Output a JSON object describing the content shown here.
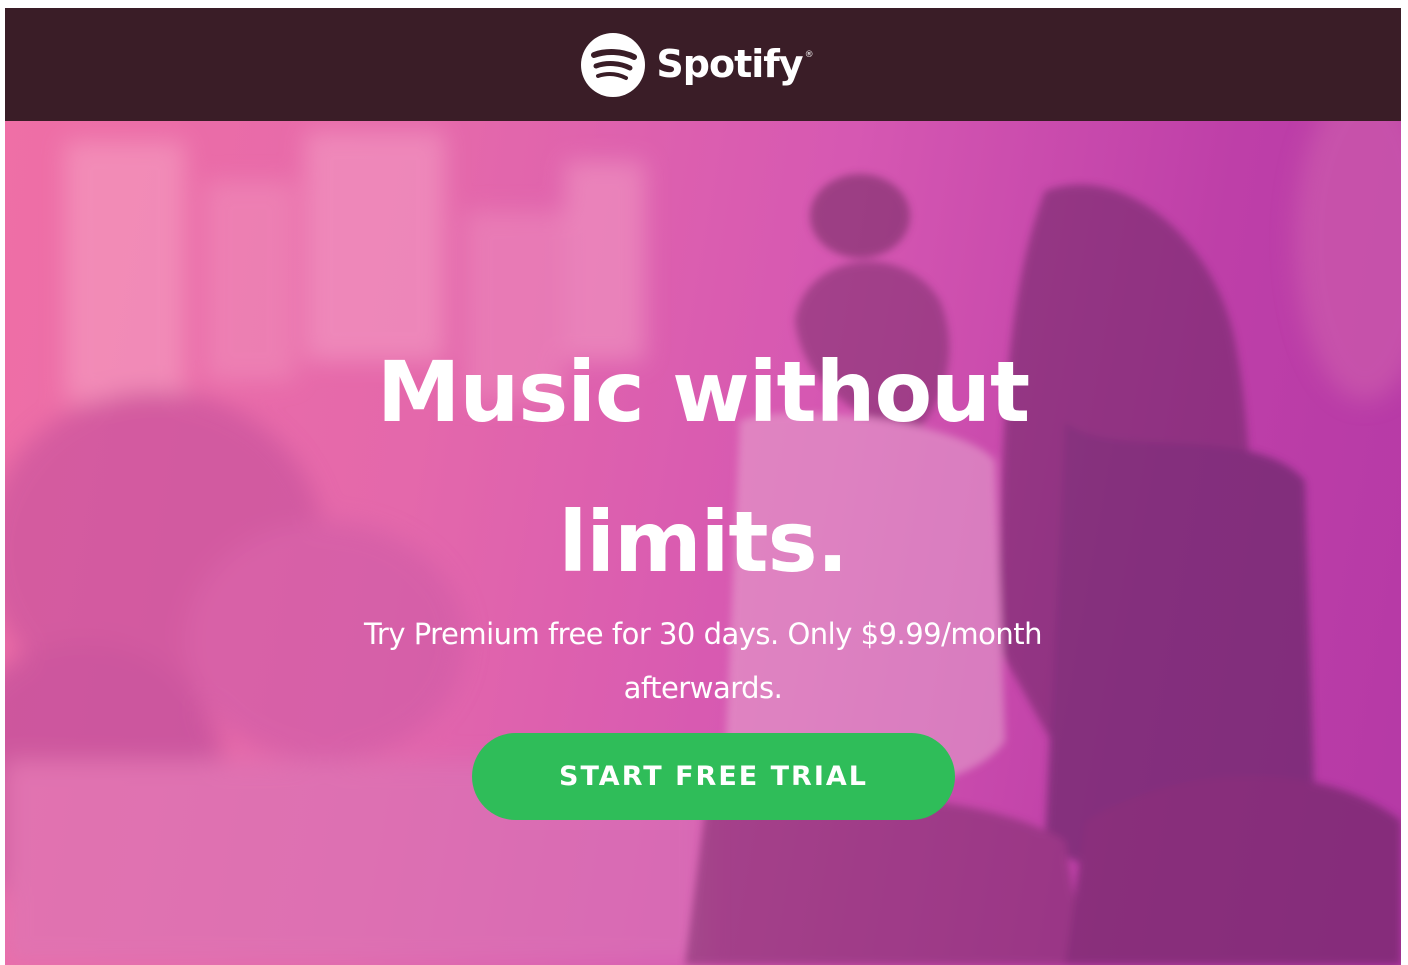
{
  "header": {
    "logo": {
      "wordmark": "Spotify",
      "trademark": "®",
      "icon": "spotify-logo-icon"
    }
  },
  "hero": {
    "headline_line1": "Music without",
    "headline_line2": "limits.",
    "subline_line1": "Try Premium free for 30 days. Only $9.99/month",
    "subline_line2": "afterwards.",
    "cta_label": "START FREE TRIAL"
  },
  "colors": {
    "header_bg": "#3a1d27",
    "hero_pink": "#ef6fa6",
    "hero_magenta": "#b539a6",
    "cta_green": "#2fbd59",
    "text": "#ffffff"
  }
}
